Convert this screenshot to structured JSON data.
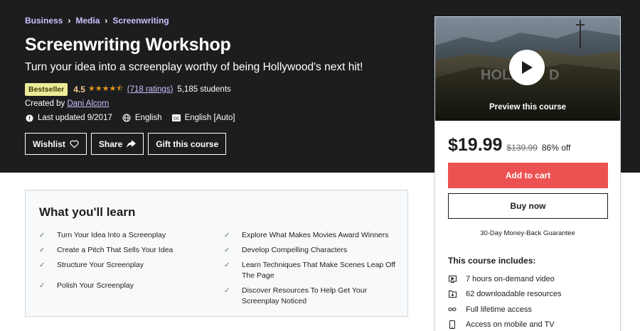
{
  "breadcrumb": [
    "Business",
    "Media",
    "Screenwriting"
  ],
  "course": {
    "title": "Screenwriting Workshop",
    "subtitle": "Turn your idea into a screenplay worthy of being Hollywood's next hit!",
    "badge": "Bestseller",
    "rating": "4.5",
    "stars": "★★★★⯪",
    "ratings_count": "(718 ratings)",
    "students": "5,185 students",
    "created_by_label": "Created by",
    "author": "Dani Alcorn",
    "last_updated": "Last updated 9/2017",
    "language": "English",
    "captions": "English [Auto]"
  },
  "actions": {
    "wishlist": "Wishlist",
    "share": "Share",
    "gift": "Gift this course"
  },
  "sidebar": {
    "preview_label": "Preview this course",
    "price": "$19.99",
    "original_price": "$139.99",
    "discount": "86% off",
    "add_to_cart": "Add to cart",
    "buy_now": "Buy now",
    "guarantee": "30-Day Money-Back Guarantee",
    "includes_title": "This course includes:",
    "includes": [
      {
        "icon": "video-icon",
        "text": "7 hours on-demand video"
      },
      {
        "icon": "download-icon",
        "text": "62 downloadable resources"
      },
      {
        "icon": "infinity-icon",
        "text": "Full lifetime access"
      },
      {
        "icon": "mobile-icon",
        "text": "Access on mobile and TV"
      }
    ]
  },
  "learn": {
    "title": "What you'll learn",
    "left": [
      "Turn Your Idea Into a Screenplay",
      "Create a Pitch That Sells Your Idea",
      "Structure Your Screenplay",
      "Polish Your Screenplay"
    ],
    "right": [
      "Explore What Makes Movies Award Winners",
      "Develop Compelling Characters",
      "Learn Techniques That Make Scenes Leap Off The Page",
      "Discover Resources To Help Get Your Screenplay Noticed"
    ]
  },
  "colors": {
    "hero_bg": "#1c1d1f",
    "link_purple": "#cec0fc",
    "star_orange": "#e59819",
    "badge_bg": "#eceb98",
    "cart_red": "#ec5252"
  }
}
